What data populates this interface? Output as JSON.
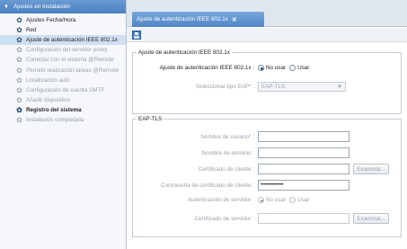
{
  "sidebar": {
    "header": "Ajustes en instalación",
    "items": [
      {
        "label": "Ajustes Fecha/Hora",
        "state": "normal"
      },
      {
        "label": "Red",
        "state": "normal"
      },
      {
        "label": "Ajuste de autenticación IEEE 802.1x",
        "state": "selected"
      },
      {
        "label": "Configuración del servidor proxy",
        "state": "disabled"
      },
      {
        "label": "Conectar con el sistema @Remote",
        "state": "disabled"
      },
      {
        "label": "Permitir realización tareas @Remote",
        "state": "disabled"
      },
      {
        "label": "Localización auto",
        "state": "disabled"
      },
      {
        "label": "Configuración de cuenta SMTP",
        "state": "disabled"
      },
      {
        "label": "Añadir dispositivo",
        "state": "disabled"
      },
      {
        "label": "Registro del sistema",
        "state": "bold"
      },
      {
        "label": "Instalación completada",
        "state": "disabled"
      }
    ]
  },
  "tab": {
    "label": "Ajuste de autenticación IEEE 802.1x",
    "close": "✕"
  },
  "section1": {
    "legend": "Ajuste de autenticación IEEE 802.1x",
    "auth_label": "Ajuste de autenticación IEEE 802.1x :",
    "radio_no": "No usar",
    "radio_yes": "Usar",
    "selected": "No usar",
    "eap_type_label": "Seleccionar tipo EAP* :",
    "eap_type_value": "EAP-TLS"
  },
  "section2": {
    "legend": "EAP-TLS",
    "username_label": "Nombre de usuario* :",
    "username_value": "",
    "domain_label": "Nombre de dominio :",
    "domain_value": "",
    "client_cert_label": "Certificado de cliente :",
    "client_cert_value": "",
    "browse1": "Examinar...",
    "password_label": "Contraseña de certificado de cliente :",
    "password_value": "••••••••••••••",
    "server_auth_label": "Autenticación de servidor :",
    "server_radio_no": "No usar",
    "server_radio_yes": "Usar",
    "server_selected": "No usar",
    "server_cert_label": "Certificado de servidor :",
    "server_cert_value": "",
    "browse2": "Examinar..."
  },
  "colors": {
    "accent": "#4f84c4",
    "header": "#5a8cc8",
    "selected_row": "#cfe0f3"
  }
}
